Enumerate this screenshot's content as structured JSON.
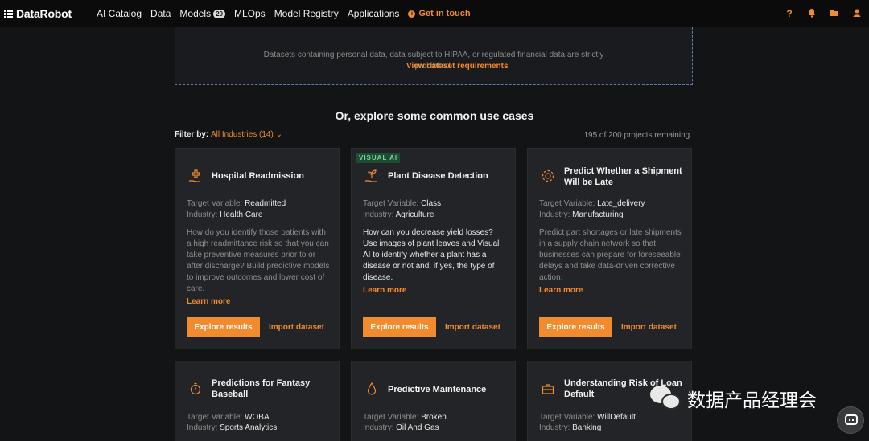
{
  "nav": {
    "brand_a": "Data",
    "brand_b": "Robot",
    "links": [
      "AI Catalog",
      "Data",
      "Models",
      "MLOps",
      "Model Registry",
      "Applications"
    ],
    "models_count": "20",
    "get_in_touch": "Get in touch",
    "right_icons": [
      "help-icon",
      "bell-icon",
      "folder-icon",
      "user-icon"
    ],
    "accent": "#f28a2e"
  },
  "dropzone": {
    "note": "Datasets containing personal data, data subject to HIPAA, or regulated financial data are strictly prohibited.",
    "link": "View dataset requirements"
  },
  "usecases": {
    "heading": "Or, explore some common use cases",
    "filter_label": "Filter by:",
    "filter_value": "All Industries (14)",
    "remaining": "195 of 200 projects remaining."
  },
  "labels": {
    "target": "Target Variable:",
    "industry": "Industry:",
    "learn": "Learn more",
    "explore": "Explore results",
    "import": "Import dataset",
    "visual_ai": "VISUAL AI"
  },
  "cards": [
    {
      "title": "Hospital Readmission",
      "icon": "medical-hand-icon",
      "target": "Readmitted",
      "industry": "Health Care",
      "desc": "How do you identify those patients with a high readmittance risk so that you can take preventive measures prior to or after discharge? Build predictive models to improve outcomes and lower cost of care."
    },
    {
      "title": "Plant Disease Detection",
      "icon": "plant-hand-icon",
      "target": "Class",
      "industry": "Agriculture",
      "desc": "How can you decrease yield losses? Use images of plant leaves and Visual AI to identify whether a plant has a disease or not and, if yes, the type of disease."
    },
    {
      "title": "Predict Whether a Shipment Will be Late",
      "icon": "gear-icon",
      "target": "Late_delivery",
      "industry": "Manufacturing",
      "desc": "Predict part shortages or late shipments in a supply chain network so that businesses can prepare for foreseeable delays and take data-driven corrective action."
    },
    {
      "title": "Predictions for Fantasy Baseball",
      "icon": "stopwatch-icon",
      "target": "WOBA",
      "industry": "Sports Analytics"
    },
    {
      "title": "Predictive Maintenance",
      "icon": "oil-drop-icon",
      "target": "Broken",
      "industry": "Oil And Gas"
    },
    {
      "title": "Understanding Risk of Loan Default",
      "icon": "briefcase-icon",
      "target": "WillDefault",
      "industry": "Banking"
    }
  ],
  "watermark": "数据产品经理会"
}
